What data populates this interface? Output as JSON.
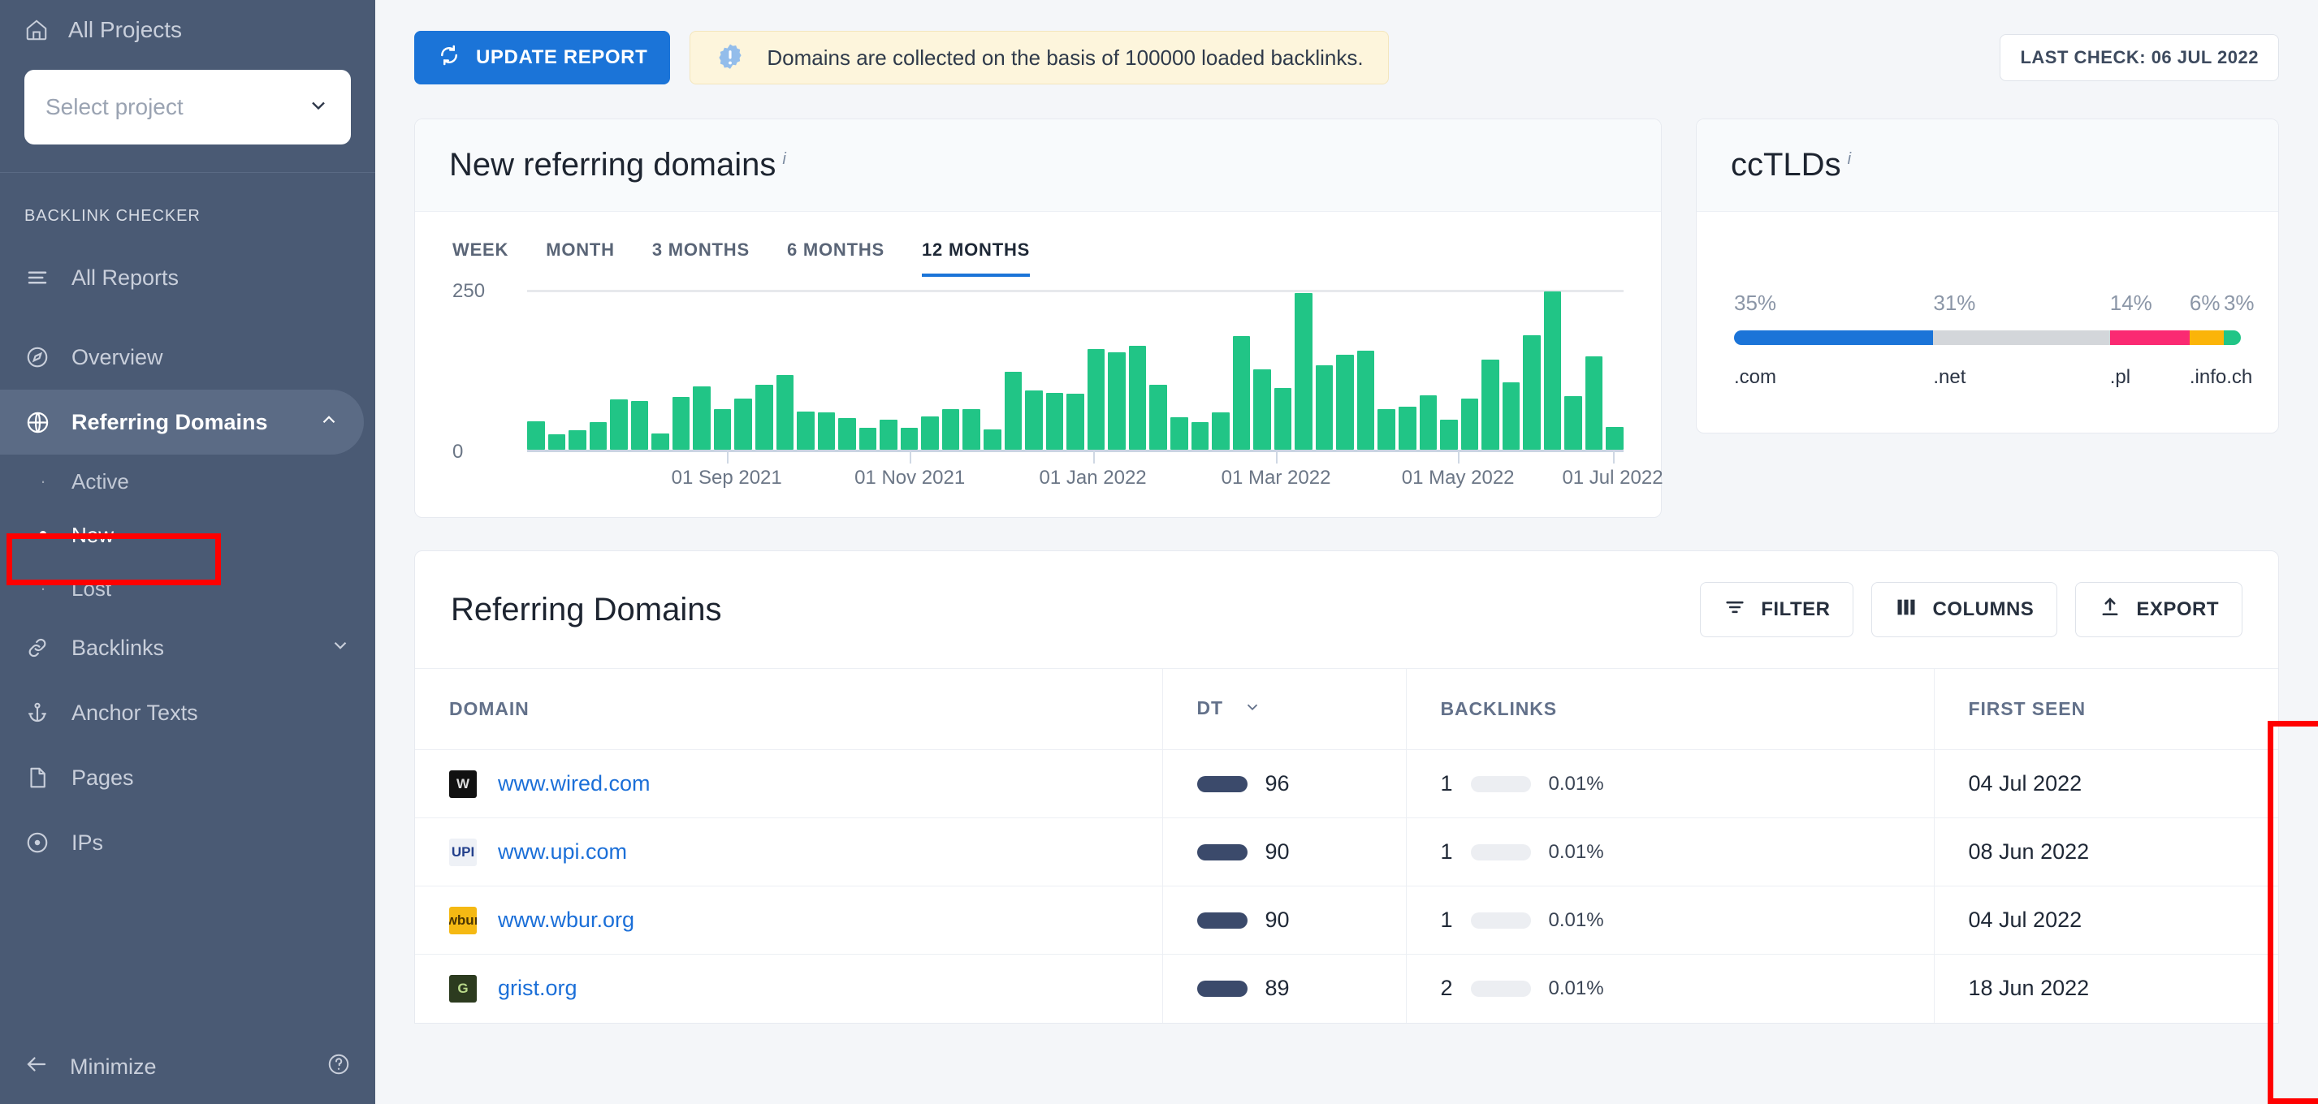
{
  "sidebar": {
    "all_projects": "All Projects",
    "project_select_placeholder": "Select project",
    "section_label": "BACKLINK CHECKER",
    "all_reports": "All Reports",
    "items": [
      {
        "label": "Overview",
        "icon": "compass-icon"
      },
      {
        "label": "Referring Domains",
        "icon": "globe-icon"
      },
      {
        "label": "Backlinks",
        "icon": "link-icon"
      },
      {
        "label": "Anchor Texts",
        "icon": "anchor-icon"
      },
      {
        "label": "Pages",
        "icon": "page-icon"
      },
      {
        "label": "IPs",
        "icon": "target-icon"
      }
    ],
    "subitems": [
      {
        "label": "Active"
      },
      {
        "label": "New"
      },
      {
        "label": "Lost"
      }
    ],
    "minimize": "Minimize"
  },
  "toolbar": {
    "update_report": "UPDATE REPORT",
    "notice": "Domains are collected on the basis of 100000 loaded backlinks.",
    "last_check": "LAST CHECK: 06 JUL 2022"
  },
  "new_domains_card": {
    "title": "New referring domains",
    "info_mark": "i",
    "tabs": [
      "WEEK",
      "MONTH",
      "3 MONTHS",
      "6 MONTHS",
      "12 MONTHS"
    ],
    "active_tab": "12 MONTHS"
  },
  "cctld_card": {
    "title": "ccTLDs",
    "info_mark": "i"
  },
  "table": {
    "title": "Referring Domains",
    "buttons": [
      {
        "label": "FILTER",
        "icon": "filter-icon"
      },
      {
        "label": "COLUMNS",
        "icon": "columns-icon"
      },
      {
        "label": "EXPORT",
        "icon": "export-icon"
      }
    ],
    "columns": [
      "DOMAIN",
      "DT",
      "BACKLINKS",
      "FIRST SEEN"
    ],
    "sorted_column": "DT",
    "rows": [
      {
        "domain": "www.wired.com",
        "favicon_letter": "W",
        "favicon_bg": "#111111",
        "favicon_fg": "#dddddd",
        "dt": "96",
        "backlinks": "1",
        "percent": "0.01%",
        "first_seen": "04 Jul 2022"
      },
      {
        "domain": "www.upi.com",
        "favicon_letter": "UPI",
        "favicon_bg": "#eef1f6",
        "favicon_fg": "#24418c",
        "dt": "90",
        "backlinks": "1",
        "percent": "0.01%",
        "first_seen": "08 Jun 2022"
      },
      {
        "domain": "www.wbur.org",
        "favicon_letter": "wbur",
        "favicon_bg": "#f5b913",
        "favicon_fg": "#4a3504",
        "dt": "90",
        "backlinks": "1",
        "percent": "0.01%",
        "first_seen": "04 Jul 2022"
      },
      {
        "domain": "grist.org",
        "favicon_letter": "G",
        "favicon_bg": "#2c3b1f",
        "favicon_fg": "#b9d98a",
        "dt": "89",
        "backlinks": "2",
        "percent": "0.01%",
        "first_seen": "18 Jun 2022"
      }
    ]
  },
  "colors": {
    "accent_blue": "#1b74d8",
    "bar_green": "#21c586",
    "sidebar_bg": "#4a5a74",
    "annotation_red": "#ff0000",
    "link_blue": "#1b6fd8"
  },
  "chart_data": [
    {
      "type": "bar",
      "title": "New referring domains",
      "xlabel": "",
      "ylabel": "",
      "ylim": [
        0,
        250
      ],
      "ytick_labels": [
        "250",
        "0"
      ],
      "grid": true,
      "legend": "none",
      "tick_labels": [
        "01 Sep 2021",
        "01 Nov 2021",
        "01 Jan 2022",
        "01 Mar 2022",
        "01 May 2022",
        "01 Jul 2022"
      ],
      "tick_positions_pct": [
        18.2,
        34.9,
        51.6,
        68.3,
        84.9,
        99.0
      ],
      "values": [
        44,
        24,
        30,
        43,
        79,
        76,
        25,
        83,
        99,
        63,
        80,
        102,
        117,
        60,
        59,
        49,
        34,
        47,
        34,
        52,
        64,
        64,
        32,
        122,
        93,
        89,
        87,
        157,
        152,
        163,
        101,
        51,
        43,
        58,
        178,
        126,
        96,
        245,
        132,
        148,
        155,
        63,
        67,
        85,
        47,
        80,
        141,
        105,
        179,
        247,
        84,
        146,
        35
      ]
    },
    {
      "type": "bar",
      "orientation": "stacked-horizontal",
      "title": "ccTLDs",
      "categories": [
        ".com",
        ".net",
        ".pl",
        ".info",
        ".ch"
      ],
      "values": [
        35,
        31,
        14,
        6,
        3
      ],
      "value_labels": [
        "35%",
        "31%",
        "14%",
        "6%",
        "3%"
      ],
      "colors": [
        "#1b74d8",
        "#d3d6da",
        "#fa2a72",
        "#fbb409",
        "#21c586"
      ],
      "unit": "%"
    }
  ]
}
